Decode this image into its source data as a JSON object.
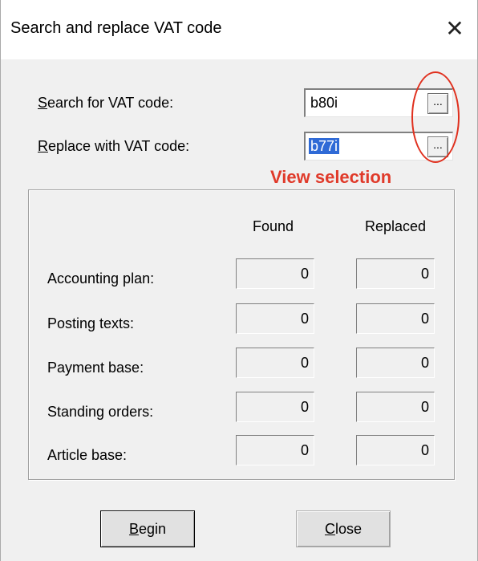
{
  "window": {
    "title": "Search and replace VAT code",
    "close_glyph": "✕"
  },
  "form": {
    "search_label_hotkey": "S",
    "search_label_rest": "earch for VAT code:",
    "search_value": "b80i",
    "replace_label_hotkey": "R",
    "replace_label_rest": "eplace with VAT code:",
    "replace_value": "b77i",
    "browse_label": "..."
  },
  "annotation": {
    "text": "View selection",
    "color": "#e03a2a"
  },
  "results": {
    "col_found": "Found",
    "col_replaced": "Replaced",
    "rows": [
      {
        "label": "Accounting plan:",
        "found": "0",
        "replaced": "0"
      },
      {
        "label": "Posting texts:",
        "found": "0",
        "replaced": "0"
      },
      {
        "label": "Payment base:",
        "found": "0",
        "replaced": "0"
      },
      {
        "label": "Standing orders:",
        "found": "0",
        "replaced": "0"
      },
      {
        "label": "Article base:",
        "found": "0",
        "replaced": "0"
      }
    ]
  },
  "buttons": {
    "begin_hotkey": "B",
    "begin_rest": "egin",
    "close_hotkey": "C",
    "close_rest": "lose"
  }
}
